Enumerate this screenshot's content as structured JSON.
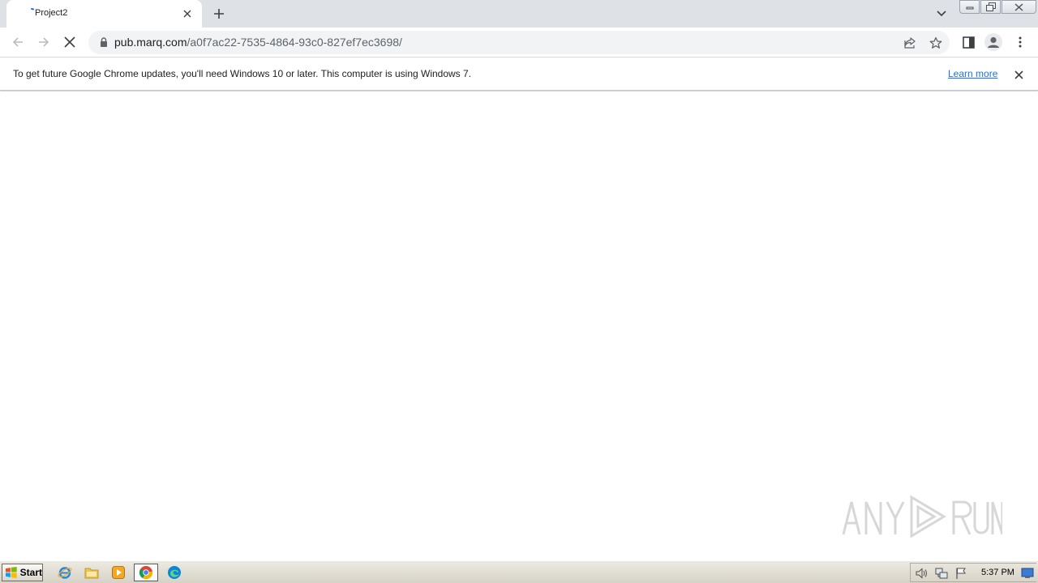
{
  "tab": {
    "title": "Project2"
  },
  "address_bar": {
    "host": "pub.marq.com",
    "path": "/a0f7ac22-7535-4864-93c0-827ef7ec3698/"
  },
  "infobar": {
    "message": "To get future Google Chrome updates, you'll need Windows 10 or later. This computer is using Windows 7.",
    "link_label": "Learn more"
  },
  "taskbar": {
    "start_label": "Start",
    "clock": "5:37 PM"
  },
  "icons": {
    "tab": [
      "loading-spinner-icon",
      "close-icon",
      "plus-icon",
      "chevron-down-icon"
    ],
    "window": [
      "minimize-icon",
      "restore-icon",
      "close-icon"
    ],
    "toolbar": [
      "back-arrow-icon",
      "forward-arrow-icon",
      "stop-icon",
      "lock-icon",
      "share-icon",
      "star-icon",
      "side-panel-icon",
      "profile-icon",
      "kebab-menu-icon"
    ],
    "taskbar": [
      "windows-flag-icon",
      "internet-explorer-icon",
      "folder-icon",
      "media-player-icon",
      "chrome-icon",
      "edge-icon",
      "speaker-icon",
      "network-icon",
      "action-center-flag-icon",
      "show-desktop-icon"
    ]
  },
  "colors": {
    "tab_strip": "#dee1e6",
    "link": "#1a73e8",
    "omnibox": "#f1f3f4"
  }
}
